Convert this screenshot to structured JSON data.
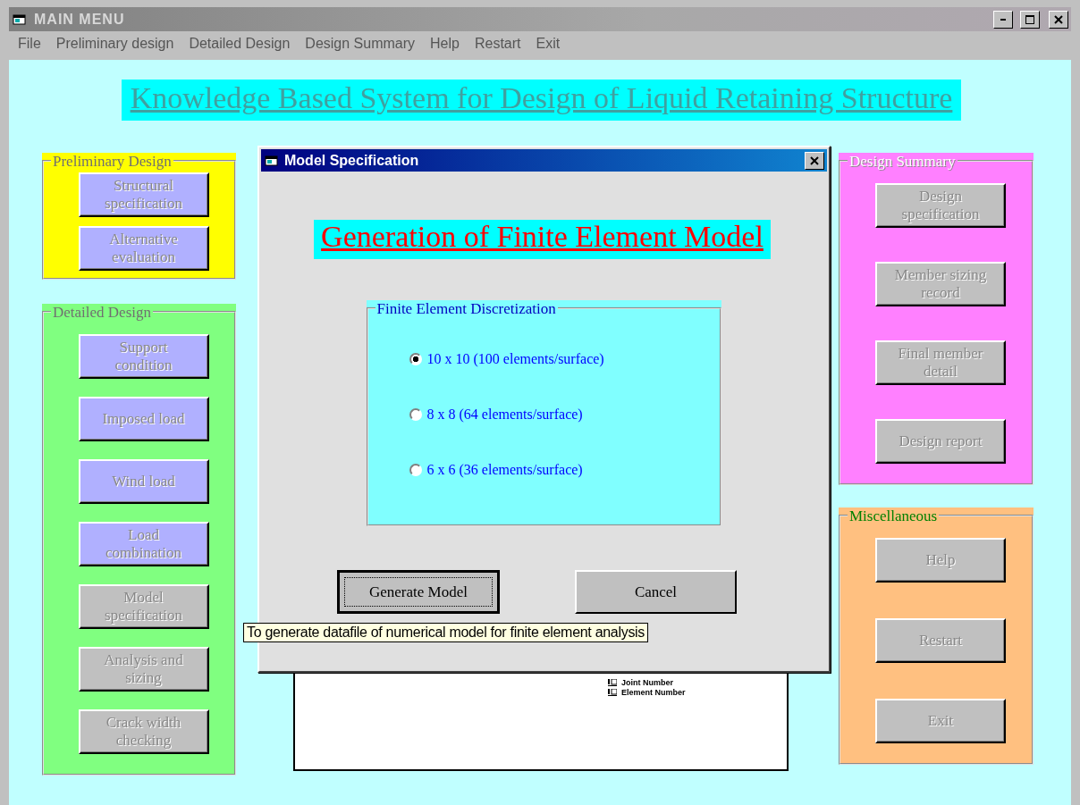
{
  "window": {
    "title": "MAIN MENU"
  },
  "menu": [
    {
      "label": "File"
    },
    {
      "label": "Preliminary design"
    },
    {
      "label": "Detailed Design"
    },
    {
      "label": "Design Summary"
    },
    {
      "label": "Help"
    },
    {
      "label": "Restart"
    },
    {
      "label": "Exit"
    }
  ],
  "heading": "Knowledge Based System for Design of Liquid Retaining Structure",
  "left_groups": [
    {
      "title": "Preliminary Design",
      "color": "#ffff00",
      "buttons": [
        {
          "label": "Structural specification",
          "color": "#b0b0ff"
        },
        {
          "label": "Alternative evaluation",
          "color": "#b0b0ff"
        }
      ]
    },
    {
      "title": "Detailed Design",
      "color": "#80ff80",
      "buttons": [
        {
          "label": "Support condition",
          "color": "#b0b0ff"
        },
        {
          "label": "Imposed load",
          "color": "#b0b0ff"
        },
        {
          "label": "Wind load",
          "color": "#b0b0ff"
        },
        {
          "label": "Load combination",
          "color": "#b0b0ff"
        },
        {
          "label": "Model specification",
          "color": "#c0c0c0"
        },
        {
          "label": "Analysis and sizing",
          "color": "#c0c0c0"
        },
        {
          "label": "Crack width checking",
          "color": "#c0c0c0"
        }
      ]
    }
  ],
  "right_groups": [
    {
      "title": "Design Summary",
      "color": "#ff80ff",
      "buttons": [
        {
          "label": "Design specification",
          "color": "#c0c0c0"
        },
        {
          "label": "Member sizing record",
          "color": "#c0c0c0"
        },
        {
          "label": "Final member detail",
          "color": "#c0c0c0"
        },
        {
          "label": "Design report",
          "color": "#c0c0c0"
        }
      ]
    },
    {
      "title": "Miscellaneous",
      "color": "#ffc080",
      "buttons": [
        {
          "label": "Help",
          "color": "#c0c0c0"
        },
        {
          "label": "Restart",
          "color": "#c0c0c0"
        },
        {
          "label": "Exit",
          "color": "#c0c0c0"
        }
      ]
    }
  ],
  "document": {
    "legend": [
      "Joint Number",
      "Element Number"
    ]
  },
  "dialog": {
    "title": "Model Specification",
    "heading": "Generation of Finite Element Model",
    "frame_title": "Finite Element Discretization",
    "options": [
      {
        "label": "10 x 10 (100 elements/surface)",
        "selected": true
      },
      {
        "label": "8 x 8 (64 elements/surface)",
        "selected": false
      },
      {
        "label": "6 x 6 (36 elements/surface)",
        "selected": false
      }
    ],
    "buttons": [
      {
        "label": "Generate Model",
        "focused": true
      },
      {
        "label": "Cancel",
        "focused": false
      }
    ],
    "tooltip": "To generate datafile of numerical model for finite element analysis"
  }
}
